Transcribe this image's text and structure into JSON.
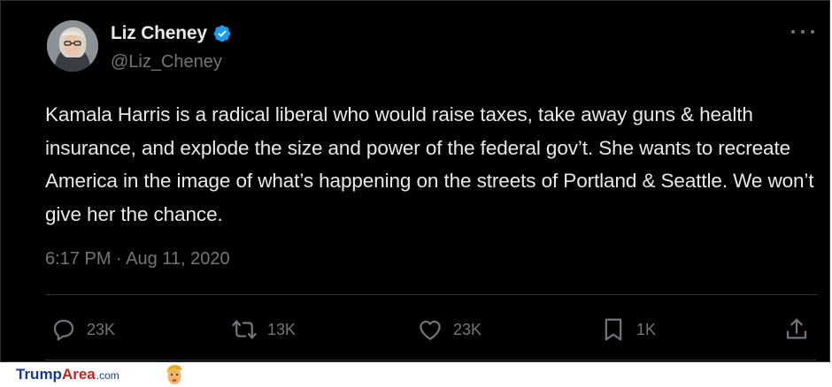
{
  "tweet": {
    "author": {
      "name": "Liz Cheney",
      "handle": "@Liz_Cheney",
      "verified": true
    },
    "text": "Kamala Harris is a radical liberal who would raise taxes, take away guns & health insurance, and explode the size and power of the federal gov’t. She wants to recreate America in the image of what’s happening on the streets of Portland & Seattle. We won’t give her the chance.",
    "timestamp": "6:17 PM · Aug 11, 2020",
    "actions": {
      "reply": {
        "icon": "reply-icon",
        "count": "23K"
      },
      "retweet": {
        "icon": "retweet-icon",
        "count": "13K"
      },
      "like": {
        "icon": "heart-icon",
        "count": "23K"
      },
      "bookmark": {
        "icon": "bookmark-icon",
        "count": "1K"
      },
      "share": {
        "icon": "share-icon"
      }
    }
  },
  "watermark": {
    "part1": "Trump",
    "part2": "Area",
    "part3": ".com"
  },
  "colors": {
    "background": "#000000",
    "text": "#e7e9ea",
    "muted": "#71767b",
    "divider": "#2f3336",
    "verified": "#1d9bf0"
  }
}
